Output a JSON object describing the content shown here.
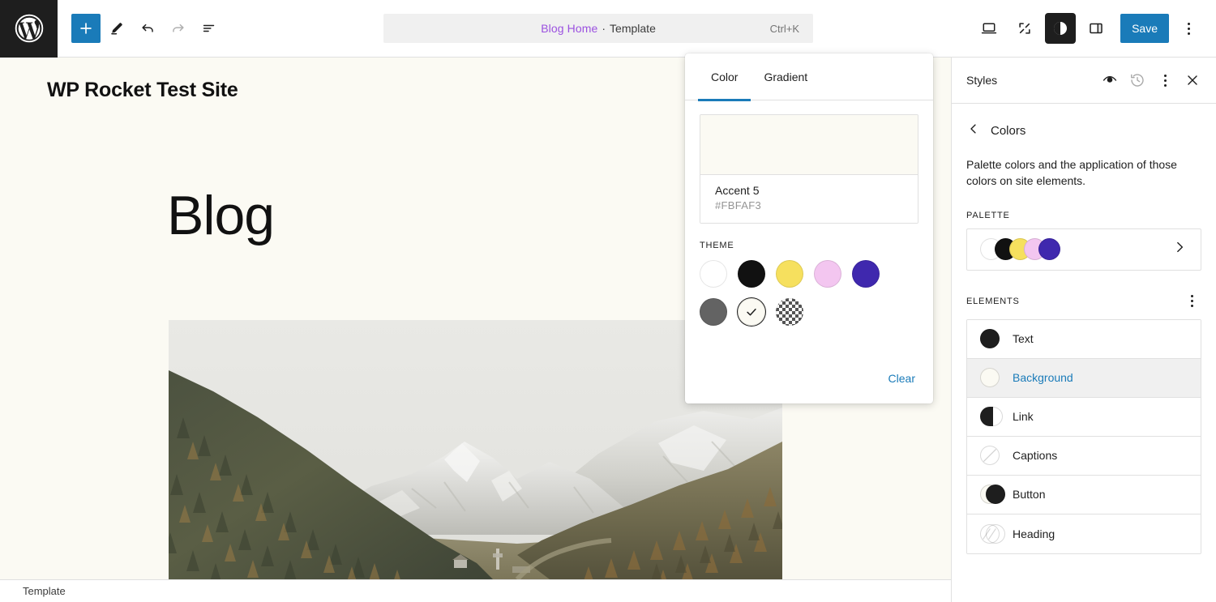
{
  "topbar": {
    "logo_icon": "wordpress-logo-icon",
    "tools": [
      {
        "name": "block-inserter-button",
        "icon": "plus-icon",
        "label": "Toggle block inserter",
        "state": "primary"
      },
      {
        "name": "edit-mode-button",
        "icon": "pencil-icon",
        "label": "Edit",
        "state": "default"
      },
      {
        "name": "undo-button",
        "icon": "undo-icon",
        "label": "Undo",
        "state": "default"
      },
      {
        "name": "redo-button",
        "icon": "redo-icon",
        "label": "Redo",
        "state": "disabled"
      },
      {
        "name": "list-view-button",
        "icon": "list-view-icon",
        "label": "Document Overview",
        "state": "default"
      }
    ],
    "document": {
      "title": "Blog Home",
      "separator": "·",
      "subtitle": "Template",
      "shortcut": "Ctrl+K"
    },
    "right_tools": [
      {
        "name": "view-device-button",
        "icon": "laptop-icon",
        "label": "View",
        "state": "default"
      },
      {
        "name": "zoom-out-button",
        "icon": "expand-icon",
        "label": "Zoom out",
        "state": "default"
      },
      {
        "name": "styles-button",
        "icon": "contrast-circle-icon",
        "label": "Styles",
        "state": "active"
      },
      {
        "name": "settings-sidebar-button",
        "icon": "sidebar-panel-icon",
        "label": "Settings",
        "state": "default"
      }
    ],
    "save_label": "Save",
    "options_icon": "kebab-menu-icon",
    "accent_color": "#1a7bb9",
    "title_color": "#9b51e0"
  },
  "canvas": {
    "background_color": "#FBFAF3",
    "site_title": "WP Rocket Test Site",
    "page_heading": "Blog",
    "featured_image_alt": "mountain-valley-photo"
  },
  "bottombar": {
    "breadcrumb": "Template"
  },
  "color_popover": {
    "tabs": [
      {
        "label": "Color",
        "active": true
      },
      {
        "label": "Gradient",
        "active": false
      }
    ],
    "selected": {
      "name": "Accent 5",
      "hex": "#FBFAF3"
    },
    "palette_label": "THEME",
    "swatches": [
      {
        "name": "swatch-white",
        "hex": "#FFFFFF",
        "selected": false,
        "type": "solid"
      },
      {
        "name": "swatch-black",
        "hex": "#111111",
        "selected": false,
        "type": "solid"
      },
      {
        "name": "swatch-yellow",
        "hex": "#F6E05E",
        "selected": false,
        "type": "solid"
      },
      {
        "name": "swatch-pink",
        "hex": "#F3C6F0",
        "selected": false,
        "type": "solid"
      },
      {
        "name": "swatch-purple",
        "hex": "#3F28AE",
        "selected": false,
        "type": "solid"
      },
      {
        "name": "swatch-gray",
        "hex": "#636363",
        "selected": false,
        "type": "solid"
      },
      {
        "name": "swatch-accent-5",
        "hex": "#FBFAF3",
        "selected": true,
        "type": "solid"
      },
      {
        "name": "swatch-transparent",
        "hex": "transparent",
        "selected": false,
        "type": "checker"
      }
    ],
    "clear_label": "Clear"
  },
  "styles_sidebar": {
    "title": "Styles",
    "header_actions": [
      {
        "name": "style-book-button",
        "icon": "eye-icon",
        "state": "default"
      },
      {
        "name": "revisions-button",
        "icon": "clock-history-icon",
        "state": "disabled"
      },
      {
        "name": "styles-more-menu-button",
        "icon": "kebab-menu-icon",
        "state": "default"
      },
      {
        "name": "close-styles-button",
        "icon": "close-icon",
        "state": "default"
      }
    ],
    "back_icon": "chevron-left-icon",
    "breadcrumb": "Colors",
    "description": "Palette colors and the application of those colors on site elements.",
    "palette_section_label": "PALETTE",
    "palette_preview": [
      "#FFFFFF",
      "#111111",
      "#F6E05E",
      "#F3C6F0",
      "#3F28AE"
    ],
    "palette_chevron_icon": "chevron-right-icon",
    "elements_section_label": "ELEMENTS",
    "elements_menu_icon": "kebab-menu-icon",
    "elements": [
      {
        "name": "element-text",
        "label": "Text",
        "indicator": "solid-dark",
        "active": false
      },
      {
        "name": "element-background",
        "label": "Background",
        "indicator": "solid-light",
        "active": true
      },
      {
        "name": "element-link",
        "label": "Link",
        "indicator": "split-dark",
        "active": false
      },
      {
        "name": "element-captions",
        "label": "Captions",
        "indicator": "empty-slash",
        "active": false
      },
      {
        "name": "element-button",
        "label": "Button",
        "indicator": "double-dark",
        "active": false
      },
      {
        "name": "element-heading",
        "label": "Heading",
        "indicator": "double-empty",
        "active": false
      }
    ]
  }
}
